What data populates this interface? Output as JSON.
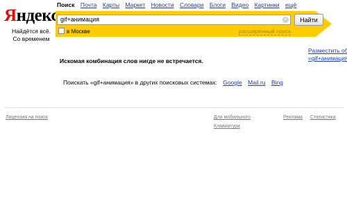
{
  "logo": {
    "first_letter": "Я",
    "rest": "ндекс"
  },
  "slogan": {
    "line1": "Найдётся всё.",
    "line2": "Со временем"
  },
  "nav": {
    "items": [
      "Поиск",
      "Почта",
      "Карты",
      "Маркет",
      "Новости",
      "Словари",
      "Блоги",
      "Видео",
      "Картинки",
      "ещё"
    ],
    "active": "Поиск"
  },
  "search": {
    "value": "gif+анимация",
    "button_label": "Найти"
  },
  "region": {
    "label": "в Москве",
    "checked": false
  },
  "advanced_search": "расширенный поиск",
  "ad": {
    "line1": "Разместить об",
    "line2": "«gif+анимация"
  },
  "no_results": "Искомая комбинация слов нигде не встречается.",
  "other_engines": {
    "prefix": "Поискать «gif+анимация» в других поисковых системах:",
    "engines": [
      "Google",
      "Mail.ru",
      "Bing"
    ]
  },
  "footer": {
    "license": "Лицензия на поиск",
    "mobile": "Для мобильного",
    "keyboard": "Клавиатура",
    "ads": "Реклама",
    "stats": "Статистика"
  },
  "colors": {
    "accent_yellow": "#ffcc00",
    "logo_red": "#ff0000",
    "link": "#1a3dc1"
  }
}
